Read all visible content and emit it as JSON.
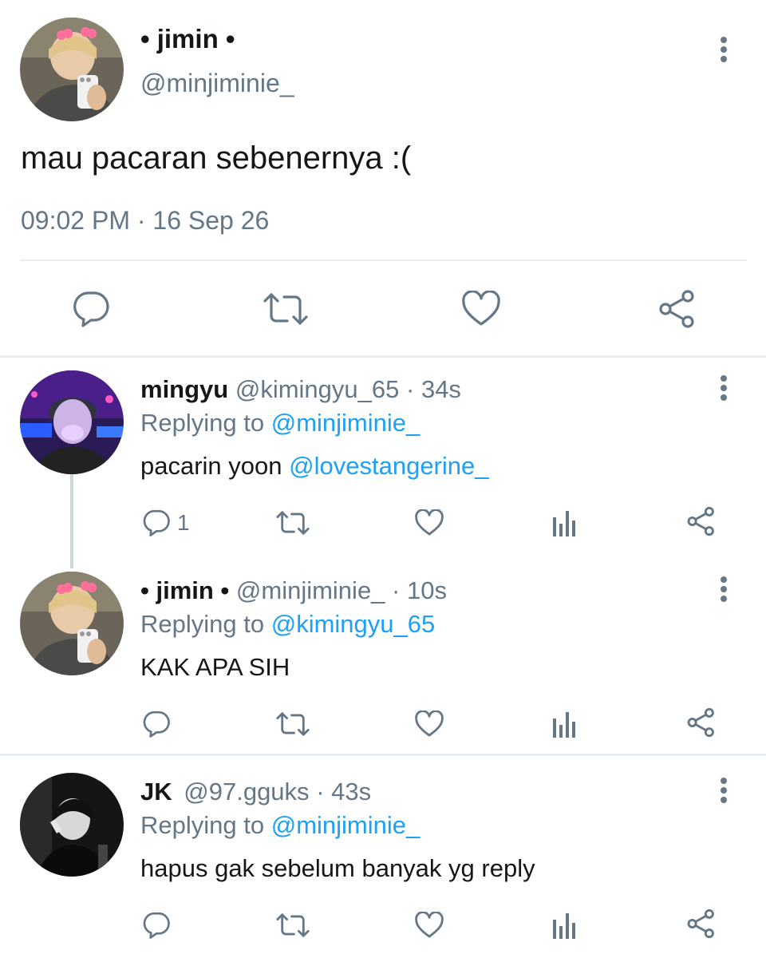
{
  "tweet": {
    "author_name": "• jimin •",
    "author_handle": "@minjiminie_",
    "text": "mau pacaran sebenernya :(",
    "time": "09:02 PM",
    "date_separator": "·",
    "date": "16 Sep 26"
  },
  "actions_icons": [
    "reply-icon",
    "retweet-icon",
    "like-icon",
    "share-icon"
  ],
  "replies": [
    {
      "name": "mingyu",
      "handle": "@kimingyu_65",
      "dot": "·",
      "age": "34s",
      "replying_prefix": "Replying to",
      "replying_to": "@minjiminie_",
      "text": "pacarin yoon",
      "text_mention": "@lovestangerine_",
      "reply_count": "1"
    },
    {
      "name": "• jimin •",
      "handle": "@minjiminie_",
      "dot": "·",
      "age": "10s",
      "replying_prefix": "Replying to",
      "replying_to": "@kimingyu_65",
      "text": "KAK APA SIH"
    },
    {
      "name": "JK",
      "handle": "@97.gguks",
      "dot": "·",
      "age": "43s",
      "replying_prefix": "Replying to",
      "replying_to": "@minjiminie_",
      "text": "hapus gak sebelum banyak yg reply"
    }
  ],
  "colors": {
    "link": "#1da1f2",
    "muted": "#657786",
    "divider": "#e6ecf0"
  }
}
